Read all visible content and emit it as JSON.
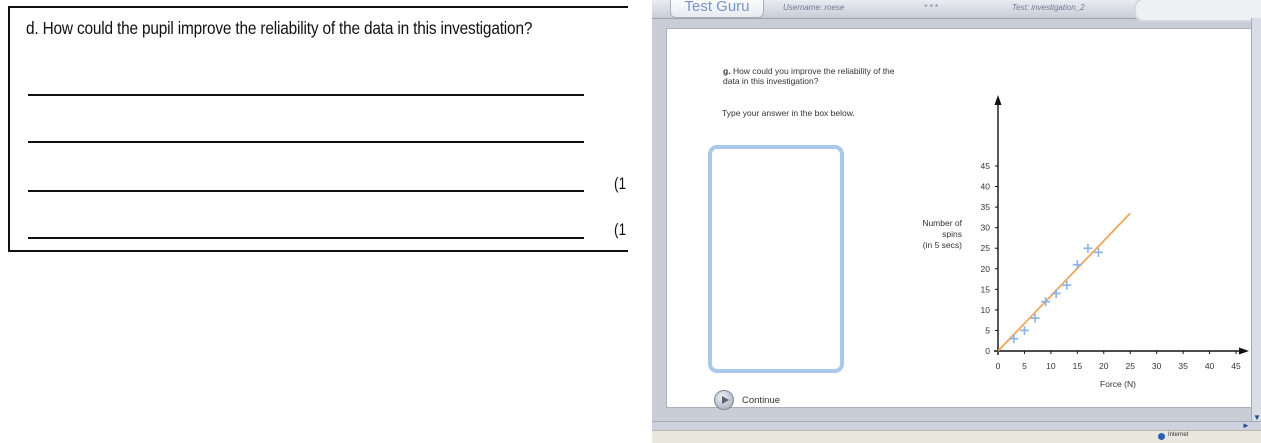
{
  "paper": {
    "question": "d.  How could the pupil improve the reliability of the data in this investigation?",
    "marks": [
      "(1",
      "(1"
    ]
  },
  "app": {
    "logo": "Test Guru",
    "username": "Username: roese",
    "dots": "* * *",
    "test_name": "Test: investigation_2",
    "question_number": "g.",
    "question_text": "How could you improve the reliability of the data in this investigation?",
    "instruction": "Type your answer in the box below.",
    "answer_value": "",
    "continue_label": "Continue",
    "status_text": "Internet"
  },
  "colors": {
    "axis": "#111111",
    "line": "#f0a55a",
    "points": "#8ab4e8",
    "answer_border": "#a9c8ec",
    "logo_text": "#7a93c6"
  },
  "chart_data": {
    "type": "scatter",
    "ylabel": [
      "Number of",
      "spins",
      "(in 5 secs)"
    ],
    "xlabel": "Force (N)",
    "x_ticks": [
      0,
      5,
      10,
      15,
      20,
      25,
      30,
      35,
      40,
      45
    ],
    "y_ticks": [
      0,
      5,
      10,
      15,
      20,
      25,
      30,
      35,
      40,
      45
    ],
    "xlim": [
      0,
      45
    ],
    "ylim": [
      0,
      45
    ],
    "grid": false,
    "points": [
      {
        "x": 3,
        "y": 3
      },
      {
        "x": 5,
        "y": 5
      },
      {
        "x": 7,
        "y": 8
      },
      {
        "x": 9,
        "y": 12
      },
      {
        "x": 11,
        "y": 14
      },
      {
        "x": 13,
        "y": 16
      },
      {
        "x": 15,
        "y": 21
      },
      {
        "x": 17,
        "y": 25
      },
      {
        "x": 19,
        "y": 24
      }
    ],
    "fit_line": {
      "x": [
        0,
        25
      ],
      "y": [
        0,
        33.5
      ]
    }
  }
}
